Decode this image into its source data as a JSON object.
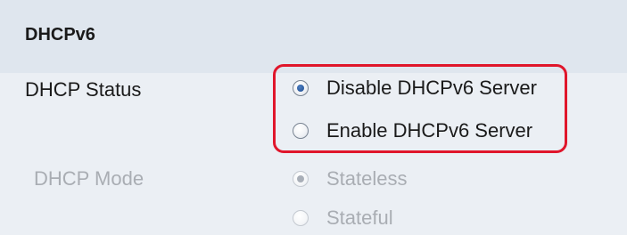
{
  "section": {
    "title": "DHCPv6"
  },
  "dhcp_status": {
    "label": "DHCP Status",
    "options": [
      {
        "label": "Disable DHCPv6 Server",
        "selected": true
      },
      {
        "label": "Enable DHCPv6 Server",
        "selected": false
      }
    ]
  },
  "dhcp_mode": {
    "label": "DHCP Mode",
    "disabled": true,
    "options": [
      {
        "label": "Stateless",
        "selected": true
      },
      {
        "label": "Stateful",
        "selected": false
      }
    ]
  },
  "colors": {
    "highlight": "#e0162b",
    "header_bg": "#dfe6ee",
    "panel_bg": "#ebeff4",
    "disabled_text": "#a9adb3"
  }
}
